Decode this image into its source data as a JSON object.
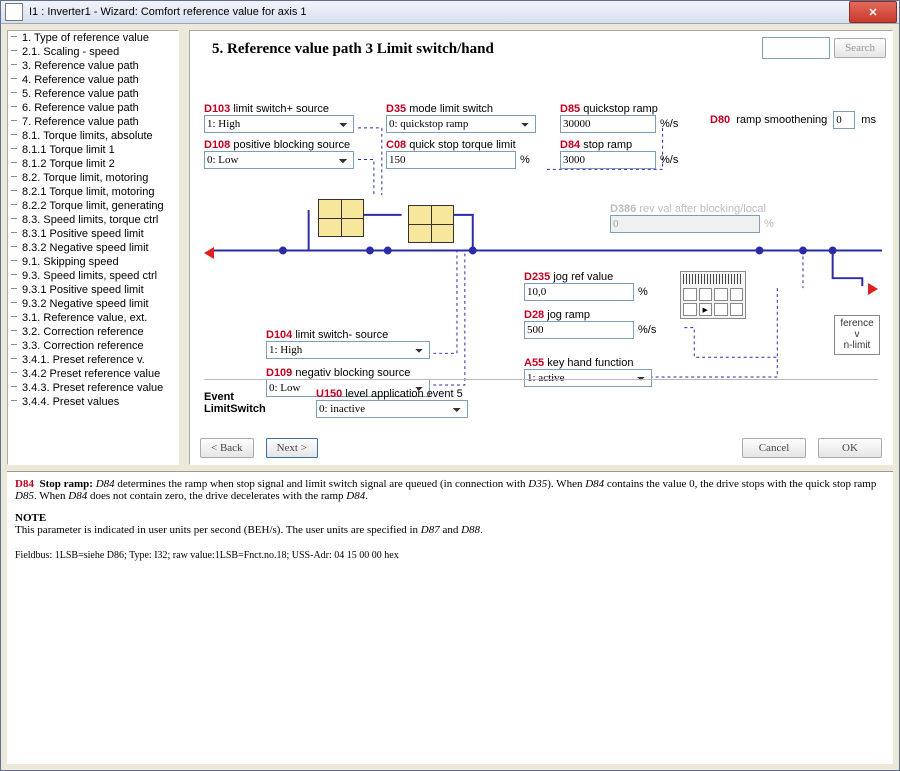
{
  "titlebar": {
    "title": "I1 : Inverter1 - Wizard: Comfort reference value for axis 1",
    "close_glyph": "✕"
  },
  "tree": [
    "1. Type of reference value",
    "2.1. Scaling - speed",
    "3. Reference value path",
    "4. Reference value path",
    "5. Reference value path",
    "6. Reference value path",
    "7. Reference value path",
    "8.1. Torque limits, absolute",
    "8.1.1 Torque limit 1",
    "8.1.2 Torque limit 2",
    "8.2. Torque limit, motoring",
    "8.2.1 Torque limit, motoring",
    "8.2.2 Torque limit, generating",
    "8.3. Speed limits, torque ctrl",
    "8.3.1 Positive speed limit",
    "8.3.2 Negative speed limit",
    "9.1. Skipping speed",
    "9.3. Speed limits, speed ctrl",
    "9.3.1 Positive speed limit",
    "9.3.2 Negative speed limit",
    "3.1. Reference value, ext.",
    "3.2. Correction reference",
    "3.3. Correction reference",
    "3.4.1. Preset reference v.",
    "3.4.2 Preset reference value",
    "3.4.3. Preset reference value",
    "3.4.4. Preset values"
  ],
  "search": {
    "placeholder": "",
    "button": "Search"
  },
  "page": {
    "title": "5. Reference value path 3 Limit switch/hand"
  },
  "params": {
    "D103": {
      "code": "D103",
      "label": "limit switch+ source",
      "value": "1: High"
    },
    "D108": {
      "code": "D108",
      "label": "positive blocking source",
      "value": "0: Low"
    },
    "D35": {
      "code": "D35",
      "label": "mode limit switch",
      "value": "0: quickstop ramp"
    },
    "C08": {
      "code": "C08",
      "label": "quick stop torque limit",
      "value": "150",
      "unit": "%"
    },
    "D85": {
      "code": "D85",
      "label": "quickstop ramp",
      "value": "30000",
      "unit": "%/s"
    },
    "D84": {
      "code": "D84",
      "label": "stop ramp",
      "value": "3000",
      "unit": "%/s"
    },
    "D80": {
      "code": "D80",
      "label": "ramp smoothening",
      "value": "0",
      "unit": "ms"
    },
    "D386": {
      "code": "D386",
      "label": "rev val after blocking/local",
      "value": "0",
      "unit": "%"
    },
    "D235": {
      "code": "D235",
      "label": "jog ref value",
      "value": "10,0",
      "unit": "%"
    },
    "D28": {
      "code": "D28",
      "label": "jog ramp",
      "value": "500",
      "unit": "%/s"
    },
    "D104": {
      "code": "D104",
      "label": "limit switch- source",
      "value": "1: High"
    },
    "D109": {
      "code": "D109",
      "label": "negativ blocking source",
      "value": "0: Low"
    },
    "A55": {
      "code": "A55",
      "label": "key hand function",
      "value": "1: active"
    },
    "U150": {
      "code": "U150",
      "label": "level application event 5",
      "value": "0: inactive"
    }
  },
  "event": {
    "label1": "Event",
    "label2": "LimitSwitch"
  },
  "refbox": {
    "line1": "ference v",
    "line2": "n-limit"
  },
  "buttons": {
    "back": "< Back",
    "next": "Next >",
    "cancel": "Cancel",
    "ok": "OK"
  },
  "desc": {
    "head_code": "D84",
    "head_name": "Stop ramp:",
    "body1_a": "D84",
    "body1_b": " determines the ramp when stop signal and limit switch signal are queued (in connection with ",
    "body1_c": "D35",
    "body1_d": "). When ",
    "body1_e": "D84",
    "body1_f": " contains the value 0, the drive stops with the quick stop ramp ",
    "body1_g": "D85",
    "body1_h": ". When ",
    "body1_i": "D84",
    "body1_j": " does not contain zero, the drive decelerates with the ramp ",
    "body1_k": "D84",
    "body1_l": ".",
    "note": "NOTE",
    "note_body_a": "This parameter is indicated in user units per second (BEH/s). The user units are specified in ",
    "note_body_b": "D87",
    "note_body_c": " and ",
    "note_body_d": "D88",
    "note_body_e": ".",
    "fieldbus": "Fieldbus: 1LSB=siehe D86; Type: I32; raw value:1LSB=Fnct.no.18; USS-Adr: 04 15 00 00 hex"
  }
}
